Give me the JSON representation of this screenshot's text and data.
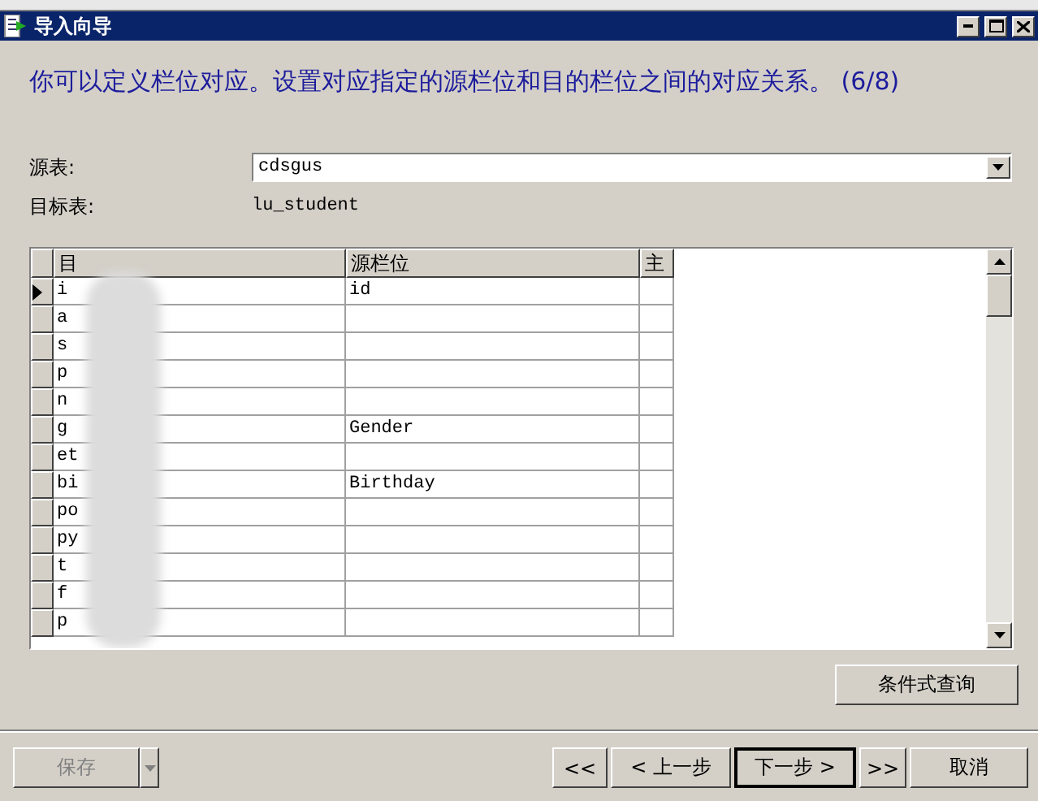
{
  "window": {
    "title": "导入向导"
  },
  "heading": "你可以定义栏位对应。设置对应指定的源栏位和目的栏位之间的对应关系。 (6/8)",
  "source_table": {
    "label": "源表:",
    "value": "cdsgus"
  },
  "target_table": {
    "label": "目标表:",
    "value": "lu_student"
  },
  "grid": {
    "columns": [
      "目",
      "源栏位",
      "主"
    ],
    "rows": [
      {
        "target": "i",
        "source": "id",
        "selected": true
      },
      {
        "target": "a",
        "source": "",
        "selected": false
      },
      {
        "target": "s",
        "source": "",
        "selected": false
      },
      {
        "target": "p",
        "source": "",
        "selected": false
      },
      {
        "target": "n",
        "source": "",
        "selected": false
      },
      {
        "target": "g",
        "source": "Gender",
        "selected": false
      },
      {
        "target": "et",
        "source": "",
        "selected": false
      },
      {
        "target": "bi",
        "source": "Birthday",
        "selected": false
      },
      {
        "target": "po",
        "source": "",
        "selected": false
      },
      {
        "target": "py",
        "source": "",
        "selected": false
      },
      {
        "target": "t",
        "source": "",
        "selected": false
      },
      {
        "target": "f",
        "source": "",
        "selected": false
      },
      {
        "target": "p",
        "source": "",
        "selected": false
      }
    ]
  },
  "query_button": "条件式查询",
  "footer": {
    "save": {
      "label": "保存",
      "disabled": true
    },
    "nav": [
      {
        "label": "<<",
        "default": false
      },
      {
        "label": "< 上一步",
        "default": false
      },
      {
        "label": "下一步 >",
        "default": true
      },
      {
        "label": ">>",
        "default": false
      },
      {
        "label": "取消",
        "default": false
      }
    ]
  }
}
